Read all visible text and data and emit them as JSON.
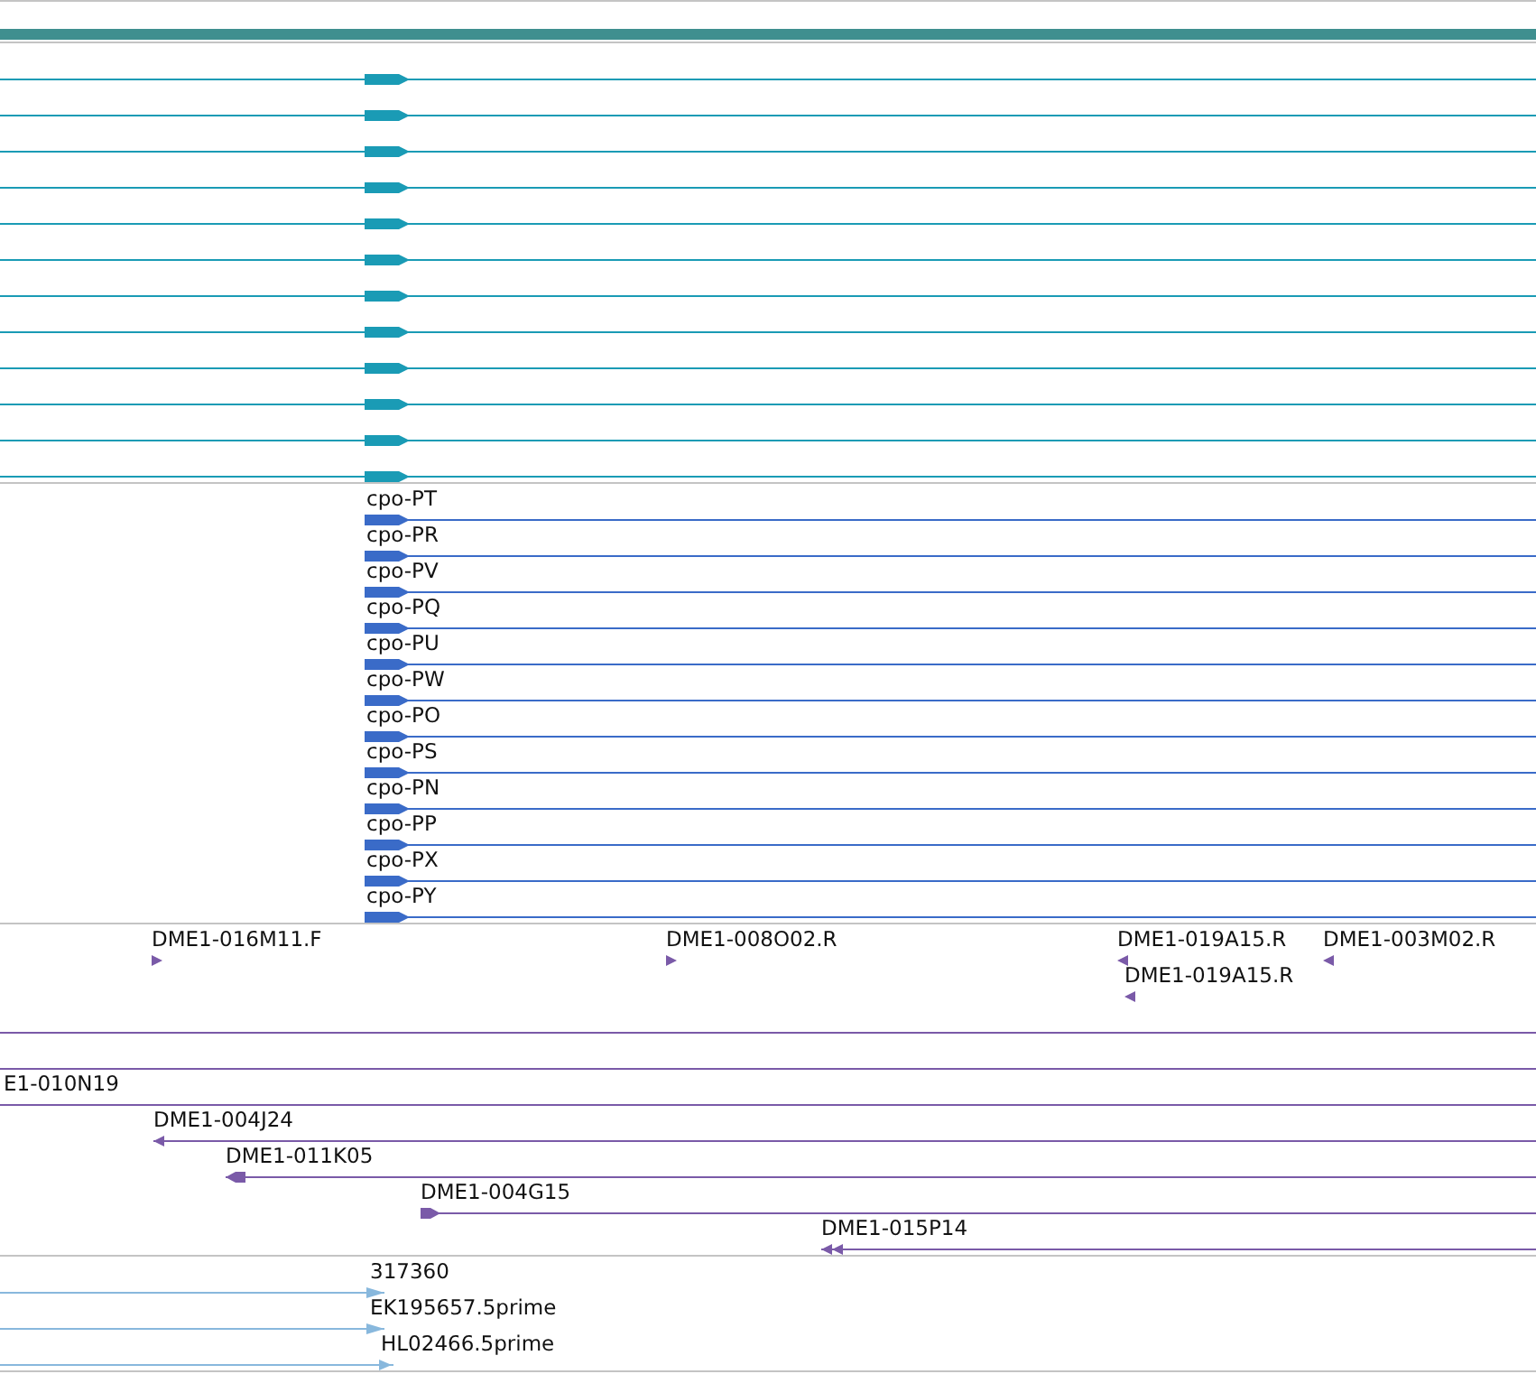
{
  "tracks": [
    {
      "color": "#1a9bb5",
      "features": [
        {
          "kind": "block",
          "reverse": false
        },
        {
          "kind": "block",
          "reverse": false
        },
        {
          "kind": "block",
          "reverse": false
        },
        {
          "kind": "block",
          "reverse": false
        },
        {
          "kind": "block",
          "reverse": false
        },
        {
          "kind": "block",
          "reverse": false
        },
        {
          "kind": "block",
          "reverse": false
        },
        {
          "kind": "block",
          "reverse": false
        },
        {
          "kind": "block",
          "reverse": false
        },
        {
          "kind": "block",
          "reverse": false
        },
        {
          "kind": "block",
          "reverse": false
        },
        {
          "kind": "block",
          "reverse": false
        }
      ]
    },
    {
      "color": "#3a6bc8",
      "features": [
        {
          "label": "cpo-PT",
          "kind": "block",
          "reverse": false
        },
        {
          "label": "cpo-PR",
          "kind": "block",
          "reverse": false
        },
        {
          "label": "cpo-PV",
          "kind": "block",
          "reverse": false
        },
        {
          "label": "cpo-PQ",
          "kind": "block",
          "reverse": false
        },
        {
          "label": "cpo-PU",
          "kind": "block",
          "reverse": false
        },
        {
          "label": "cpo-PW",
          "kind": "block",
          "reverse": false
        },
        {
          "label": "cpo-PO",
          "kind": "block",
          "reverse": false
        },
        {
          "label": "cpo-PS",
          "kind": "block",
          "reverse": false
        },
        {
          "label": "cpo-PN",
          "kind": "block",
          "reverse": false
        },
        {
          "label": "cpo-PP",
          "kind": "block",
          "reverse": false
        },
        {
          "label": "cpo-PX",
          "kind": "block",
          "reverse": false
        },
        {
          "label": "cpo-PY",
          "kind": "block",
          "reverse": false
        }
      ]
    },
    {
      "color": "#7a5aa8",
      "features": [
        {
          "label": "DME1-016M11.F",
          "kind": "arrow",
          "reverse": false
        },
        {
          "label": "DME1-008O02.R",
          "kind": "arrow",
          "reverse": false
        },
        {
          "label": "DME1-019A15.R",
          "kind": "arrow",
          "reverse": true
        },
        {
          "label": "DME1-003M02.R",
          "kind": "arrow",
          "reverse": true
        },
        {
          "label": "DME1-019A15.R",
          "kind": "arrow",
          "reverse": true
        },
        {
          "kind": "line"
        },
        {
          "kind": "line"
        },
        {
          "label": "E1-010N19",
          "kind": "line"
        },
        {
          "label": "DME1-004J24",
          "kind": "arrow",
          "reverse": true
        },
        {
          "label": "DME1-011K05",
          "kind": "block",
          "reverse": true
        },
        {
          "label": "DME1-004G15",
          "kind": "block",
          "reverse": false
        },
        {
          "label": "DME1-015P14",
          "kind": "double",
          "reverse": true
        }
      ]
    },
    {
      "color": "#88b8dd",
      "features": [
        {
          "label": "317360",
          "kind": "arrow",
          "reverse": false
        },
        {
          "label": "EK195657.5prime",
          "kind": "arrow",
          "reverse": false
        },
        {
          "label": "HL02466.5prime",
          "kind": "arrow",
          "reverse": false
        }
      ]
    }
  ]
}
